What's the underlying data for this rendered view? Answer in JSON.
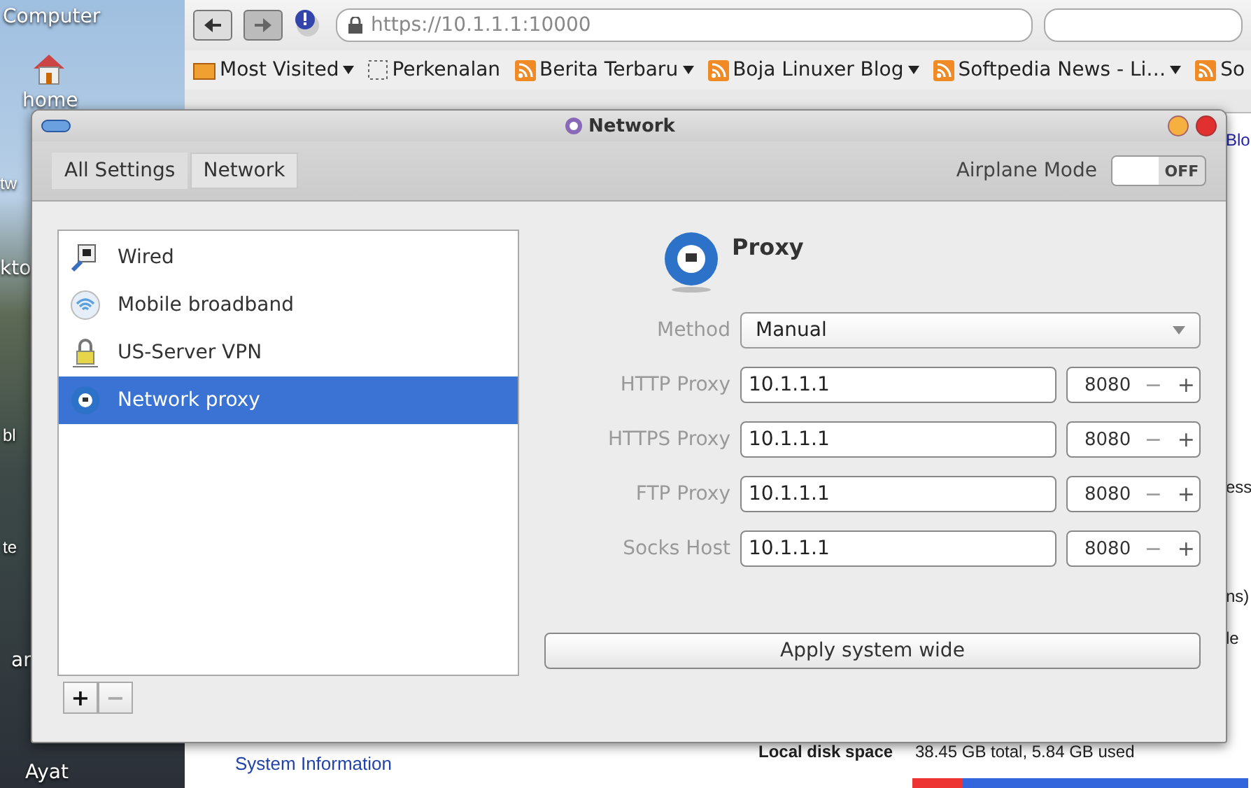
{
  "desktop": {
    "labels": [
      "Computer",
      "home",
      "tw",
      "kto",
      "bl",
      "te",
      "ar",
      "Ayat"
    ]
  },
  "browser": {
    "url": "https://10.1.1.1:10000",
    "bookmarks": [
      {
        "label": "Most Visited",
        "kind": "folder",
        "dropdown": true
      },
      {
        "label": "Perkenalan",
        "kind": "page",
        "dropdown": false
      },
      {
        "label": "Berita Terbaru",
        "kind": "feed",
        "dropdown": true
      },
      {
        "label": "Boja Linuxer Blog",
        "kind": "feed",
        "dropdown": true
      },
      {
        "label": "Softpedia News - Li…",
        "kind": "feed",
        "dropdown": true
      },
      {
        "label": "So",
        "kind": "feed",
        "dropdown": false
      }
    ],
    "side_fragments": [
      "Blo",
      "ess",
      "ns)",
      "le"
    ],
    "nav_link": "System Information",
    "disk": {
      "label": "Local disk space",
      "value": "38.45 GB total, 5.84 GB used",
      "level": 0.15
    }
  },
  "window": {
    "title": "Network"
  },
  "breadcrumbs": [
    {
      "label": "All Settings",
      "selected": false
    },
    {
      "label": "Network",
      "selected": true
    }
  ],
  "airplane_mode": {
    "label": "Airplane Mode",
    "on": false,
    "state_text": "OFF"
  },
  "devices": [
    {
      "label": "Wired",
      "kind": "wired",
      "selected": false
    },
    {
      "label": "Mobile broadband",
      "kind": "wireless",
      "selected": false
    },
    {
      "label": "US-Server VPN",
      "kind": "vpn",
      "selected": false
    },
    {
      "label": "Network proxy",
      "kind": "proxy",
      "selected": true
    }
  ],
  "list_buttons": [
    {
      "label": "+",
      "disabled": false
    },
    {
      "label": "−",
      "disabled": true
    }
  ],
  "proxy": {
    "title": "Proxy",
    "method": {
      "label": "Method",
      "value": "Manual"
    },
    "rows": [
      {
        "label": "HTTP Proxy",
        "host": "10.1.1.1",
        "port": "8080"
      },
      {
        "label": "HTTPS Proxy",
        "host": "10.1.1.1",
        "port": "8080"
      },
      {
        "label": "FTP Proxy",
        "host": "10.1.1.1",
        "port": "8080"
      },
      {
        "label": "Socks Host",
        "host": "10.1.1.1",
        "port": "8080"
      }
    ],
    "spin": [
      "−",
      "+"
    ],
    "apply": "Apply system wide"
  }
}
